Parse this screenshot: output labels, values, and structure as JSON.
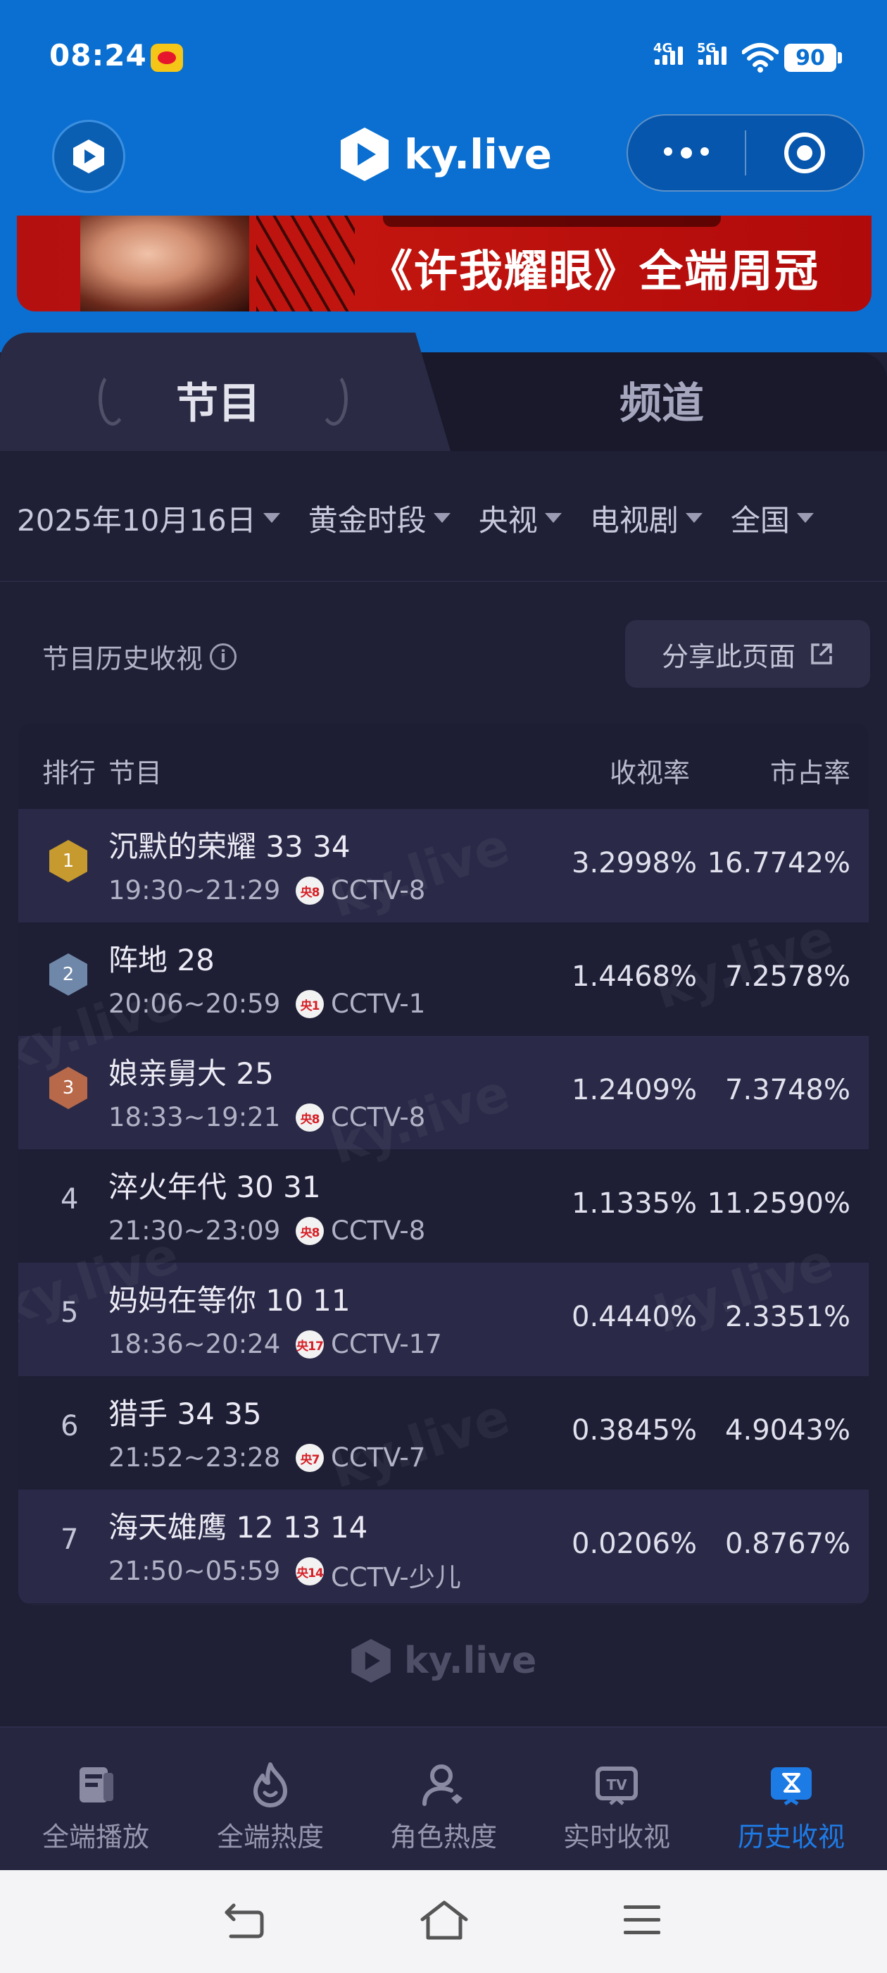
{
  "status_bar": {
    "time": "08:24",
    "net1": "4G",
    "net2": "5G",
    "battery": "90"
  },
  "header": {
    "brand": "ky.live"
  },
  "banner": {
    "text": "《许我耀眼》全端周冠"
  },
  "tabs": [
    {
      "label": "节目",
      "active": true
    },
    {
      "label": "频道",
      "active": false
    }
  ],
  "filters": [
    {
      "label": "2025年10月16日"
    },
    {
      "label": "黄金时段"
    },
    {
      "label": "央视"
    },
    {
      "label": "电视剧"
    },
    {
      "label": "全国"
    }
  ],
  "section": {
    "title": "节目历史收视",
    "share_label": "分享此页面"
  },
  "table": {
    "headers": {
      "rank": "排行",
      "program": "节目",
      "rating": "收视率",
      "share": "市占率"
    },
    "rows": [
      {
        "rank": "1",
        "medal": "gold",
        "title": "沉默的荣耀 33 34",
        "time": "19:30~21:29",
        "ch_short": "央8",
        "channel": "CCTV-8",
        "rating": "3.2998%",
        "share": "16.7742%"
      },
      {
        "rank": "2",
        "medal": "silver",
        "title": "阵地 28",
        "time": "20:06~20:59",
        "ch_short": "央1",
        "channel": "CCTV-1",
        "rating": "1.4468%",
        "share": "7.2578%"
      },
      {
        "rank": "3",
        "medal": "bronze",
        "title": "娘亲舅大 25",
        "time": "18:33~19:21",
        "ch_short": "央8",
        "channel": "CCTV-8",
        "rating": "1.2409%",
        "share": "7.3748%"
      },
      {
        "rank": "4",
        "medal": "",
        "title": "淬火年代 30 31",
        "time": "21:30~23:09",
        "ch_short": "央8",
        "channel": "CCTV-8",
        "rating": "1.1335%",
        "share": "11.2590%"
      },
      {
        "rank": "5",
        "medal": "",
        "title": "妈妈在等你 10 11",
        "time": "18:36~20:24",
        "ch_short": "央17",
        "channel": "CCTV-17",
        "rating": "0.4440%",
        "share": "2.3351%"
      },
      {
        "rank": "6",
        "medal": "",
        "title": "猎手 34 35",
        "time": "21:52~23:28",
        "ch_short": "央7",
        "channel": "CCTV-7",
        "rating": "0.3845%",
        "share": "4.9043%"
      },
      {
        "rank": "7",
        "medal": "",
        "title": "海天雄鹰 12 13 14",
        "time": "21:50~05:59",
        "ch_short": "央14",
        "channel": "CCTV-少儿",
        "rating": "0.0206%",
        "share": "0.8767%"
      }
    ]
  },
  "footer": {
    "brand": "ky.live"
  },
  "bottom_nav": [
    {
      "label": "全端播放",
      "icon": "play-book-icon",
      "active": false
    },
    {
      "label": "全端热度",
      "icon": "flame-icon",
      "active": false
    },
    {
      "label": "角色热度",
      "icon": "person-icon",
      "active": false
    },
    {
      "label": "实时收视",
      "icon": "tv-icon",
      "active": false
    },
    {
      "label": "历史收视",
      "icon": "hourglass-icon",
      "active": true
    }
  ],
  "colors": {
    "accent": "#1d7be6",
    "header_blue": "#0a6fd0",
    "background": "#1f1f36",
    "gold": "#c69a2e",
    "silver": "#6f87a8",
    "bronze": "#b8694a"
  }
}
